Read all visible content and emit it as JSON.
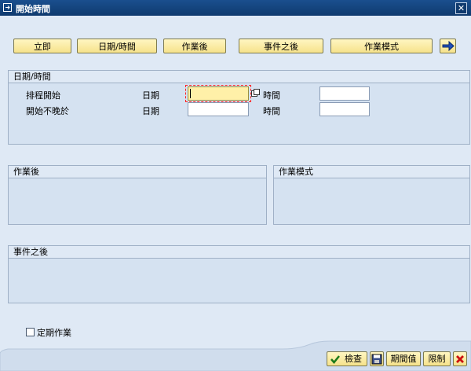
{
  "window": {
    "title": "開始時間",
    "close_symbol": "✕"
  },
  "toolbar": {
    "immediate": "立即",
    "date_time": "日期/時間",
    "after_job": "作業後",
    "after_event": "事件之後",
    "operation_mode": "作業模式"
  },
  "datetime_group": {
    "title": "日期/時間",
    "scheduled_start": "排程開始",
    "no_start_after": "開始不晚於",
    "date_label": "日期",
    "time_label": "時間",
    "start_date_value": "",
    "start_time_value": "",
    "late_date_value": "",
    "late_time_value": ""
  },
  "after_job_group": {
    "title": "作業後"
  },
  "operation_mode_group": {
    "title": "作業模式"
  },
  "after_event_group": {
    "title": "事件之後"
  },
  "periodic": {
    "label": "定期作業",
    "checked": false
  },
  "footer": {
    "check_label": "檢查",
    "period_label": "期間值",
    "restrict_label": "限制"
  },
  "colors": {
    "titlebar": "#0f3a6e",
    "background": "#dfe9f5",
    "button_fill": "#f6e28b",
    "active_field": "#fff0a8",
    "focus_border": "#ff2020"
  }
}
